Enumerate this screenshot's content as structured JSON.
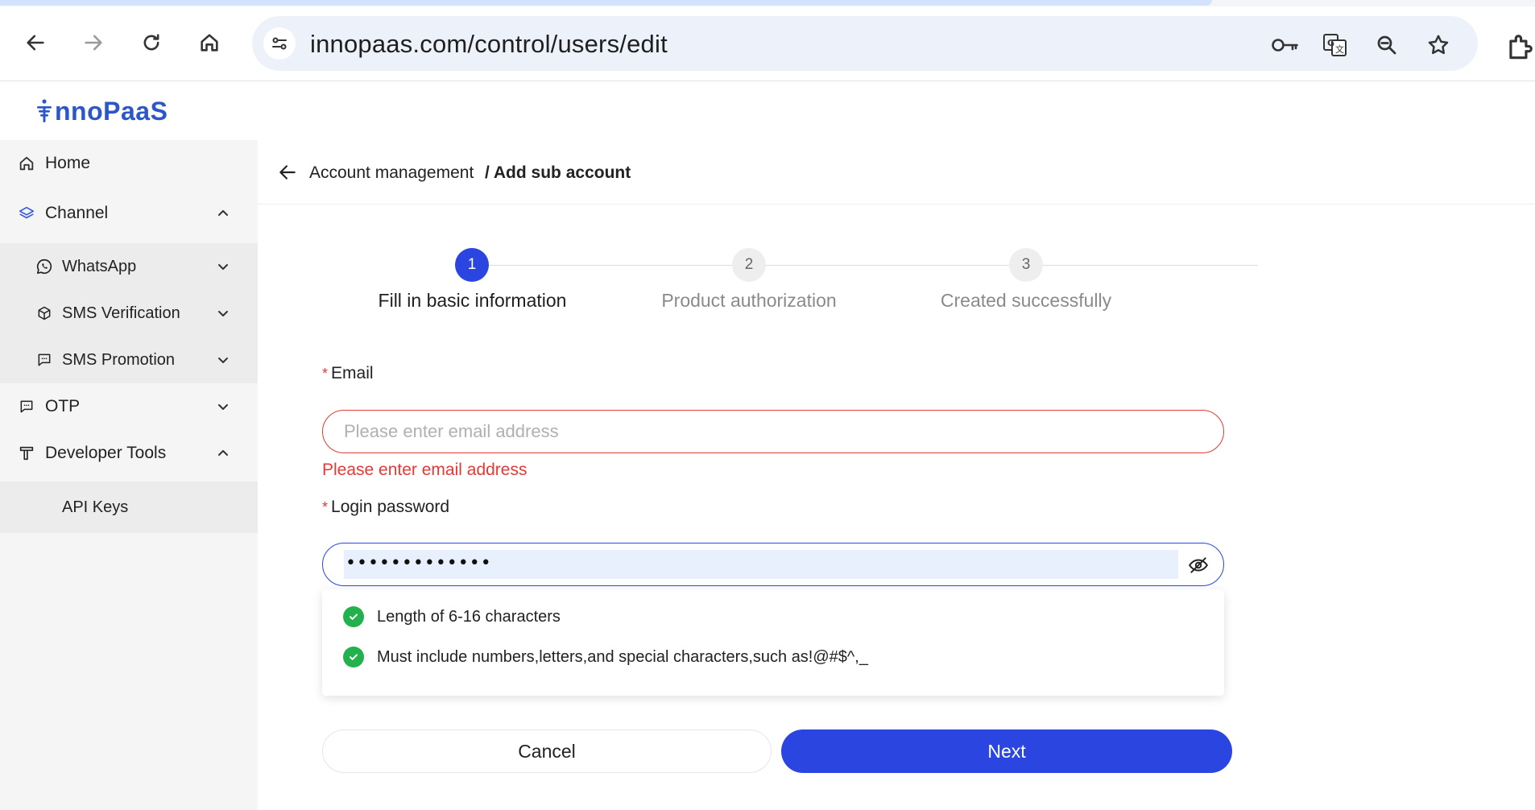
{
  "browser": {
    "url": "innopaas.com/control/users/edit",
    "icons": [
      "back-arrow-icon",
      "forward-arrow-icon",
      "reload-icon",
      "home-icon",
      "site-settings-icon",
      "password-key-icon",
      "translate-icon",
      "zoom-icon",
      "bookmark-star-icon",
      "extensions-icon"
    ]
  },
  "app": {
    "logo_text": "nnoPaaS",
    "brand_color": "#2c57c8"
  },
  "sidebar": {
    "items": [
      {
        "label": "Home",
        "icon": "home-icon"
      },
      {
        "label": "Channel",
        "icon": "layers-icon",
        "expanded": true
      },
      {
        "label": "WhatsApp",
        "icon": "whatsapp-icon",
        "sub": true
      },
      {
        "label": "SMS Verification",
        "icon": "cube-icon",
        "sub": true
      },
      {
        "label": "SMS Promotion",
        "icon": "chat-icon",
        "sub": true
      },
      {
        "label": "OTP",
        "icon": "chat-icon"
      },
      {
        "label": "Developer Tools",
        "icon": "tool-icon",
        "expanded": true
      },
      {
        "label": "API Keys",
        "sub": true
      }
    ]
  },
  "breadcrumb": {
    "parent": "Account management",
    "current": "/ Add sub account"
  },
  "steps": [
    {
      "number": "1",
      "label": "Fill in basic information",
      "active": true
    },
    {
      "number": "2",
      "label": "Product authorization",
      "active": false
    },
    {
      "number": "3",
      "label": "Created successfully",
      "active": false
    }
  ],
  "form": {
    "required_mark": "*",
    "email": {
      "label": "Email",
      "placeholder": "Please enter email address",
      "value": "",
      "error": "Please enter email address"
    },
    "password": {
      "label": "Login password",
      "masked_value": "•••••••••••••"
    },
    "password_rules": [
      {
        "text": "Length of 6-16 characters",
        "passed": true
      },
      {
        "text": "Must include numbers,letters,and special characters,such as!@#$^,_",
        "passed": true
      }
    ]
  },
  "buttons": {
    "cancel": "Cancel",
    "next": "Next"
  },
  "colors": {
    "primary": "#2a45e0",
    "error": "#e53935",
    "success": "#22b14c"
  }
}
